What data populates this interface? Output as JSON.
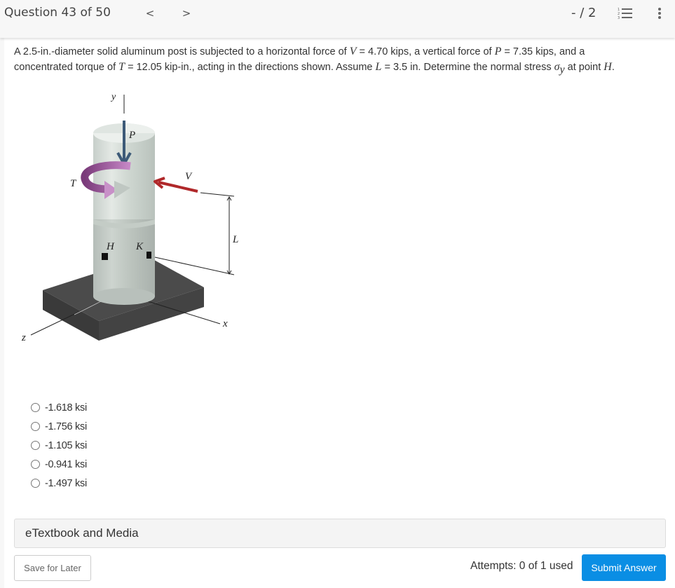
{
  "header": {
    "question_counter": "Question 43 of 50",
    "prev_label": "<",
    "next_label": ">",
    "score": "- / 2",
    "icons": [
      "numbered-list-icon",
      "more-vertical-icon"
    ]
  },
  "question": {
    "line1_a": "A 2.5-in.-diameter solid aluminum post is subjected to a horizontal force of ",
    "V_sym": "V",
    "line1_b": " = 4.70 kips, a vertical force of ",
    "P_sym": "P",
    "line1_c": " = 7.35 kips, and a",
    "line2_a": "concentrated torque of ",
    "T_sym": "T",
    "line2_b": " = 12.05 kip-in., acting in the directions shown. Assume ",
    "L_sym": "L",
    "line2_c": " = 3.5 in. Determine the normal stress ",
    "sigma_sym": "σ",
    "sigma_sub": "y",
    "line2_d": " at point ",
    "H_sym": "H",
    "line2_e": "."
  },
  "figure": {
    "labels": {
      "y": "y",
      "P": "P",
      "T": "T",
      "V": "V",
      "L": "L",
      "H": "H",
      "K": "K",
      "x": "x",
      "z": "z"
    },
    "colors": {
      "P_arrow": "#3d5a78",
      "V_arrow": "#b0282a",
      "T_arrow": "#8e4a8e",
      "post": "#d4dbd6",
      "base": "#4a4a4a"
    }
  },
  "choices": [
    {
      "label": "-1.618 ksi",
      "selected": false
    },
    {
      "label": "-1.756 ksi",
      "selected": false
    },
    {
      "label": "-1.105 ksi",
      "selected": false
    },
    {
      "label": "-0.941 ksi",
      "selected": false
    },
    {
      "label": "-1.497 ksi",
      "selected": false
    }
  ],
  "etextbook": {
    "label": "eTextbook and Media"
  },
  "footer": {
    "save_label": "Save for Later",
    "attempts": "Attempts: 0 of 1 used",
    "submit_label": "Submit Answer",
    "submit_color": "#0a8ee4"
  }
}
